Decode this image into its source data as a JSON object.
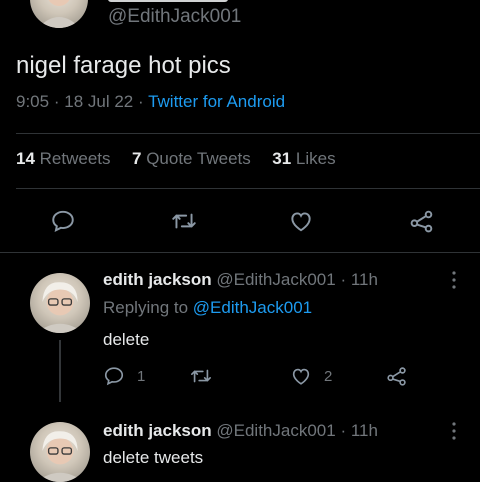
{
  "main_tweet": {
    "handle": "@EdithJack001",
    "text": "nigel farage hot pics",
    "time": "9:05",
    "date": "18 Jul 22",
    "client": "Twitter for Android",
    "dot": "·",
    "stats": {
      "retweets_count": "14",
      "retweets_label": "Retweets",
      "quotes_count": "7",
      "quotes_label": "Quote Tweets",
      "likes_count": "31",
      "likes_label": "Likes"
    },
    "actions": [
      "reply-icon",
      "retweet-icon",
      "like-icon",
      "share-icon"
    ]
  },
  "replies": [
    {
      "name": "edith jackson",
      "handle": "@EdithJack001",
      "dot": "·",
      "time": "11h",
      "replying_prefix": "Replying to",
      "replying_to": "@EdithJack001",
      "text": "delete",
      "reply_count": "1",
      "like_count": "2"
    },
    {
      "name": "edith jackson",
      "handle": "@EdithJack001",
      "dot": "·",
      "time": "11h",
      "text": "delete tweets"
    }
  ],
  "colors": {
    "background": "#000000",
    "text": "#e7e9ea",
    "muted": "#71767b",
    "link": "#1d9bf0",
    "divider": "#2f3336"
  }
}
